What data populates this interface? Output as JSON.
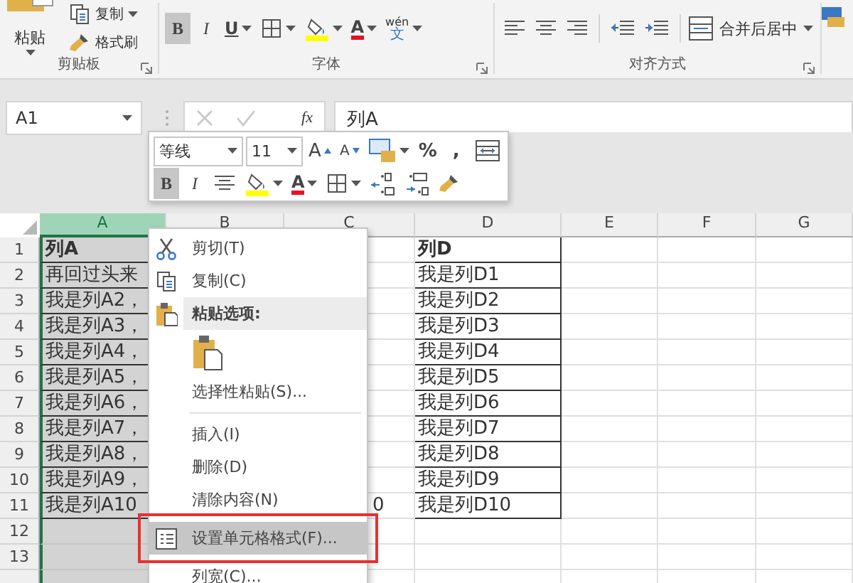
{
  "ribbon": {
    "groups": [
      {
        "label": "剪贴板",
        "kind": "clipboard",
        "paste": "粘贴",
        "items": [
          {
            "kind": "copy",
            "label": "复制"
          },
          {
            "kind": "format-painter",
            "label": "格式刷"
          }
        ]
      },
      {
        "label": "字体",
        "kind": "font",
        "tools": [
          {
            "kind": "bold",
            "label": "B",
            "selected": true
          },
          {
            "kind": "italic",
            "label": "I",
            "selected": false
          },
          {
            "kind": "underline",
            "label": "U",
            "selected": false
          },
          {
            "kind": "borders",
            "selected": false
          },
          {
            "kind": "fill",
            "selected": false
          },
          {
            "kind": "font-color",
            "label": "A",
            "selected": false
          },
          {
            "kind": "phonetic",
            "label": "wén",
            "sub": "文",
            "selected": false
          }
        ]
      },
      {
        "label": "对齐方式",
        "kind": "align",
        "merge": "合并后居中"
      }
    ]
  },
  "name_box": {
    "value": "A1"
  },
  "formula_bar": {
    "fx": "fx",
    "value": "列A"
  },
  "mini_toolbar": {
    "font": "等线",
    "size": "11",
    "row1": [
      {
        "kind": "grow-font",
        "label": "A"
      },
      {
        "kind": "shrink-font",
        "label": "A"
      },
      {
        "kind": "cell-styles"
      },
      {
        "kind": "percent",
        "label": "%"
      },
      {
        "kind": "comma",
        "label": ","
      },
      {
        "kind": "wrap"
      }
    ],
    "row2": [
      {
        "kind": "bold",
        "label": "B",
        "selected": true
      },
      {
        "kind": "italic",
        "label": "I",
        "selected": false
      },
      {
        "kind": "center",
        "selected": false
      },
      {
        "kind": "fill",
        "selected": false
      },
      {
        "kind": "font-color",
        "label": "A",
        "selected": false
      },
      {
        "kind": "borders",
        "selected": false
      },
      {
        "kind": "increase-decimal",
        "selected": false
      },
      {
        "kind": "decrease-decimal",
        "selected": false
      },
      {
        "kind": "format-painter",
        "selected": false
      }
    ]
  },
  "sheet": {
    "columns": [
      {
        "label": "A",
        "selected": true
      },
      {
        "label": "B",
        "selected": false
      },
      {
        "label": "C",
        "selected": false
      },
      {
        "label": "D",
        "selected": false
      },
      {
        "label": "E",
        "selected": false
      },
      {
        "label": "F",
        "selected": false
      },
      {
        "label": "G",
        "selected": false
      }
    ],
    "rows": [
      {
        "number": "1",
        "a": "列A",
        "d": "列D",
        "bold": true
      },
      {
        "number": "2",
        "a": "再回过头来",
        "d": "我是列D1",
        "bold": false
      },
      {
        "number": "3",
        "a": "我是列A2，",
        "d": "我是列D2",
        "bold": false
      },
      {
        "number": "4",
        "a": "我是列A3，",
        "d": "我是列D3",
        "bold": false
      },
      {
        "number": "5",
        "a": "我是列A4，",
        "d": "我是列D4",
        "bold": false
      },
      {
        "number": "6",
        "a": "我是列A5，",
        "d": "我是列D5",
        "bold": false
      },
      {
        "number": "7",
        "a": "我是列A6，",
        "d": "我是列D6",
        "bold": false
      },
      {
        "number": "8",
        "a": "我是列A7，",
        "d": "我是列D7",
        "bold": false
      },
      {
        "number": "9",
        "a": "我是列A8，",
        "d": "我是列D8",
        "bold": false
      },
      {
        "number": "10",
        "a": "我是列A9，",
        "d": "我是列D9",
        "bold": false
      },
      {
        "number": "11",
        "a": "我是列A10",
        "c": "0",
        "d": "我是列D10",
        "bold": false
      },
      {
        "number": "12",
        "bold": false
      },
      {
        "number": "13",
        "bold": false
      },
      {
        "bold": false
      }
    ]
  },
  "context_menu": {
    "items": [
      {
        "kind": "cut",
        "label": "剪切(T)",
        "highlighted": false
      },
      {
        "kind": "copy",
        "label": "复制(C)",
        "highlighted": false
      },
      {
        "kind": "paste-header",
        "label": "粘贴选项:"
      },
      {
        "kind": "paste-options"
      },
      {
        "kind": "item",
        "label": "选择性粘贴(S)...",
        "highlighted": false
      },
      {
        "kind": "separator"
      },
      {
        "kind": "item",
        "label": "插入(I)",
        "highlighted": false
      },
      {
        "kind": "item",
        "label": "删除(D)",
        "highlighted": false
      },
      {
        "kind": "item",
        "label": "清除内容(N)",
        "highlighted": false
      },
      {
        "kind": "format-cells",
        "label": "设置单元格格式(F)...",
        "highlighted": true
      },
      {
        "kind": "item",
        "label": "列宽(C)...",
        "highlighted": false
      }
    ]
  }
}
